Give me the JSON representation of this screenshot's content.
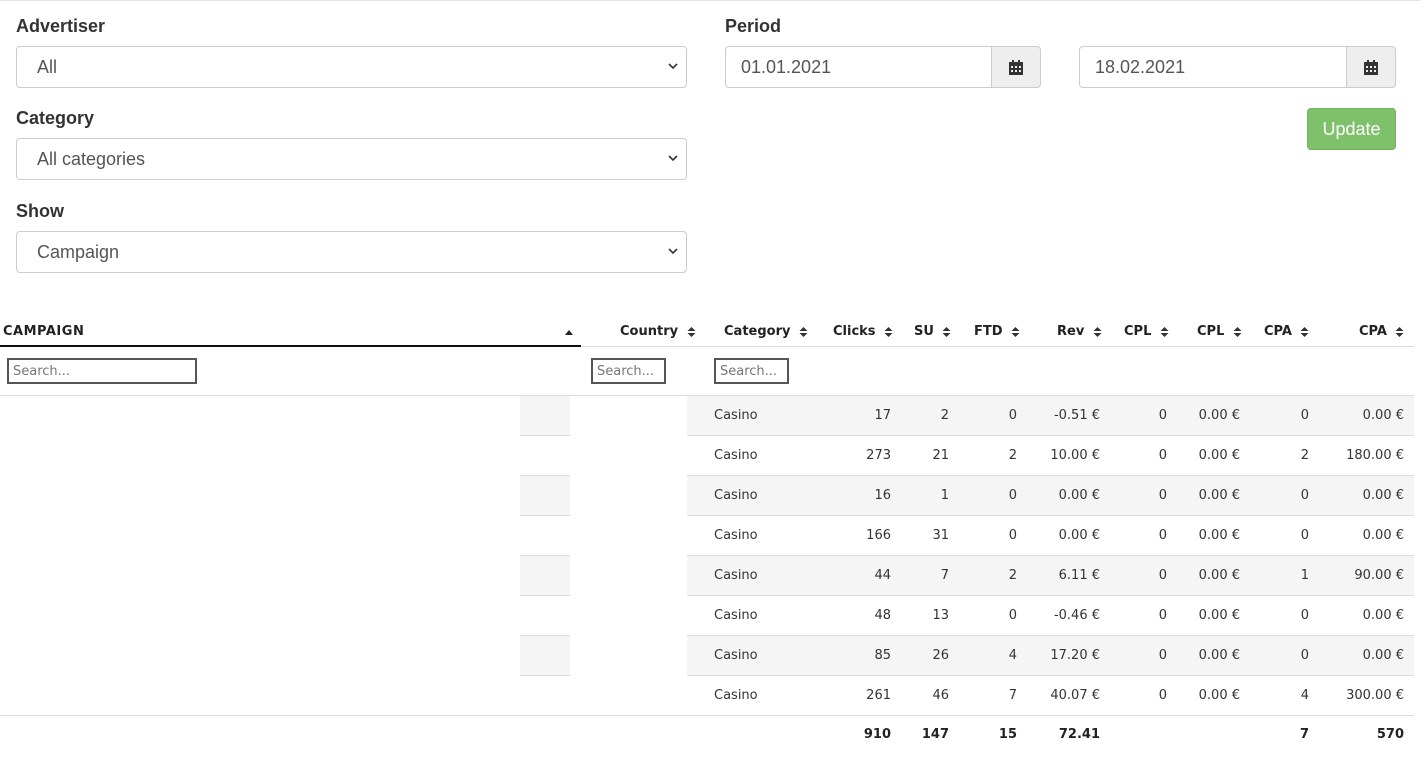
{
  "filters": {
    "advertiser_label": "Advertiser",
    "advertiser_value": "All",
    "category_label": "Category",
    "category_value": "All categories",
    "show_label": "Show",
    "show_value": "Campaign",
    "period_label": "Period",
    "date_from": "01.01.2021",
    "date_to": "18.02.2021",
    "update_label": "Update"
  },
  "colors": {
    "update_button": "#7fc06b",
    "calendar_button": "#eeeeee"
  },
  "table": {
    "headers": {
      "campaign": "CAMPAIGN",
      "country": "Country",
      "category": "Category",
      "clicks": "Clicks",
      "su": "SU",
      "ftd": "FTD",
      "rev": "Rev",
      "cpl_count": "CPL",
      "cpl_amount": "CPL",
      "cpa_count": "CPA",
      "cpa_amount": "CPA"
    },
    "search_placeholder": "Search...",
    "rows": [
      {
        "category": "Casino",
        "clicks": "17",
        "su": "2",
        "ftd": "0",
        "rev": "-0.51 €",
        "cpl": "0",
        "cpl_amt": "0.00 €",
        "cpa": "0",
        "cpa_amt": "0.00 €"
      },
      {
        "category": "Casino",
        "clicks": "273",
        "su": "21",
        "ftd": "2",
        "rev": "10.00 €",
        "cpl": "0",
        "cpl_amt": "0.00 €",
        "cpa": "2",
        "cpa_amt": "180.00 €"
      },
      {
        "category": "Casino",
        "clicks": "16",
        "su": "1",
        "ftd": "0",
        "rev": "0.00 €",
        "cpl": "0",
        "cpl_amt": "0.00 €",
        "cpa": "0",
        "cpa_amt": "0.00 €"
      },
      {
        "category": "Casino",
        "clicks": "166",
        "su": "31",
        "ftd": "0",
        "rev": "0.00 €",
        "cpl": "0",
        "cpl_amt": "0.00 €",
        "cpa": "0",
        "cpa_amt": "0.00 €"
      },
      {
        "category": "Casino",
        "clicks": "44",
        "su": "7",
        "ftd": "2",
        "rev": "6.11 €",
        "cpl": "0",
        "cpl_amt": "0.00 €",
        "cpa": "1",
        "cpa_amt": "90.00 €"
      },
      {
        "category": "Casino",
        "clicks": "48",
        "su": "13",
        "ftd": "0",
        "rev": "-0.46 €",
        "cpl": "0",
        "cpl_amt": "0.00 €",
        "cpa": "0",
        "cpa_amt": "0.00 €"
      },
      {
        "category": "Casino",
        "clicks": "85",
        "su": "26",
        "ftd": "4",
        "rev": "17.20 €",
        "cpl": "0",
        "cpl_amt": "0.00 €",
        "cpa": "0",
        "cpa_amt": "0.00 €"
      },
      {
        "category": "Casino",
        "clicks": "261",
        "su": "46",
        "ftd": "7",
        "rev": "40.07 €",
        "cpl": "0",
        "cpl_amt": "0.00 €",
        "cpa": "4",
        "cpa_amt": "300.00 €"
      }
    ],
    "totals": {
      "clicks": "910",
      "su": "147",
      "ftd": "15",
      "rev": "72.41",
      "cpa": "7",
      "cpa_amt": "570"
    }
  }
}
